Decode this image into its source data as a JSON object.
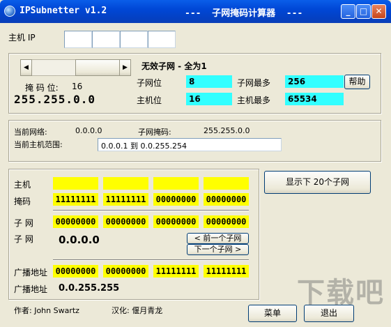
{
  "window": {
    "title_left": "IPSubnetter v1.2",
    "title_center": "---  子网掩码计算器  ---",
    "controls": {
      "minimize": "_",
      "maximize": "□",
      "close": "✕"
    }
  },
  "host_ip": {
    "label": "主机 IP",
    "octets": [
      "",
      "",
      "",
      ""
    ]
  },
  "mask_panel": {
    "scroll_left": "◀",
    "scroll_right": "▶",
    "mask_bits_label": "掩 码 位:",
    "mask_bits_value": "16",
    "mask_value": "255.255.0.0",
    "status": "无效子网 - 全为1",
    "subnet_bits_label": "子网位",
    "subnet_bits_value": "8",
    "max_subnets_label": "子网最多",
    "max_subnets_value": "256",
    "help_button": "帮助",
    "host_bits_label": "主机位",
    "host_bits_value": "16",
    "max_hosts_label": "主机最多",
    "max_hosts_value": "65534"
  },
  "network_info": {
    "current_network_label": "当前网络:",
    "current_network_value": "0.0.0.0",
    "subnet_mask_label": "子网掩码:",
    "subnet_mask_value": "255.255.0.0",
    "host_range_label": "当前主机范围:",
    "host_range_value": "0.0.0.1 到 0.0.255.254"
  },
  "binary": {
    "host_label": "主机",
    "host_bits": [
      "",
      "",
      "",
      ""
    ],
    "mask_label": "掩码",
    "mask_bits": [
      "11111111",
      "11111111",
      "00000000",
      "00000000"
    ],
    "subnet_label": "子 网",
    "subnet_bits": [
      "00000000",
      "00000000",
      "00000000",
      "00000000"
    ],
    "subnet_ip_label": "子 网",
    "subnet_ip": "0.0.0.0",
    "prev_subnet_button": "< 前一个子网",
    "next_subnet_button": "下一个子网 >",
    "broadcast_label": "广播地址",
    "broadcast_bits": [
      "00000000",
      "00000000",
      "11111111",
      "11111111"
    ],
    "broadcast_ip_label": "广播地址",
    "broadcast_ip": "0.0.255.255"
  },
  "show_subnets_button": "显示下 20个子网",
  "footer": {
    "author": "作者: John Swartz",
    "localization": "汉化: 偃月青龙",
    "menu_button": "菜单",
    "exit_button": "退出"
  },
  "watermark": "下载吧"
}
